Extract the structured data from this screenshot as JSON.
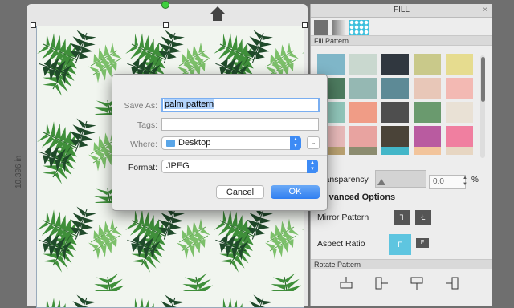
{
  "canvas": {
    "ruler_label": "10.396 in"
  },
  "panel": {
    "title": "FILL",
    "close_glyph": "×",
    "fill_types": [
      "solid-fill",
      "gradient-fill",
      "pattern-fill"
    ],
    "fill_pattern_label": "Fill Pattern",
    "transparency_label": "Transparency",
    "transparency_value": "0.0",
    "transparency_unit": "%",
    "advanced_options_label": "Advanced Options",
    "mirror_pattern_label": "Mirror Pattern",
    "aspect_ratio_label": "Aspect Ratio",
    "rotate_pattern_label": "Rotate Pattern",
    "swatch_colors": [
      [
        "#7fb6c8",
        "#c9d8cf",
        "#30373f",
        "#c9c98a",
        "#e6dc8f"
      ],
      [
        "#4d7b5f",
        "#95b8b3",
        "#5d8a96",
        "#e8c7b8",
        "#f3b9b3"
      ],
      [
        "#8fc4b8",
        "#f09c86",
        "#4e4e4e",
        "#6a9a6e",
        "#e9e1d5"
      ],
      [
        "#e6b8b8",
        "#e8a3a0",
        "#4a4338",
        "#b95ba0",
        "#f07fa0"
      ],
      [
        "#b8a070",
        "#8c8c70",
        "#43b6c8",
        "#f2c49b",
        "#e7d6c2"
      ]
    ]
  },
  "dialog": {
    "save_as_label": "Save As:",
    "save_as_value": "palm pattern",
    "tags_label": "Tags:",
    "where_label": "Where:",
    "where_value": "Desktop",
    "format_label": "Format:",
    "format_value": "JPEG",
    "cancel_label": "Cancel",
    "ok_label": "OK"
  }
}
